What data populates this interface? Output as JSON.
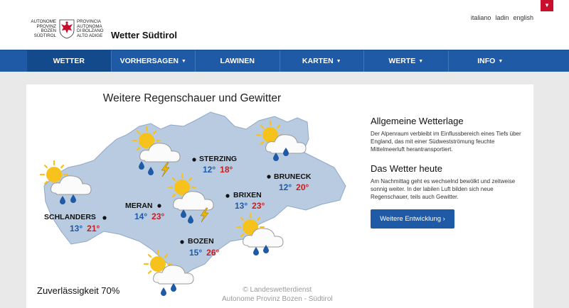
{
  "header": {
    "logo_left": [
      "AUTONOME",
      "PROVINZ",
      "BOZEN",
      "SÜDTIROL"
    ],
    "logo_right": [
      "PROVINCIA",
      "AUTONOMA",
      "DI BOLZANO",
      "ALTO ADIGE"
    ],
    "site_title": "Wetter Südtirol",
    "languages": [
      "italiano",
      "ladin",
      "english"
    ]
  },
  "nav": {
    "items": [
      {
        "label": "WETTER"
      },
      {
        "label": "VORHERSAGEN"
      },
      {
        "label": "LAWINEN"
      },
      {
        "label": "KARTEN"
      },
      {
        "label": "WERTE"
      },
      {
        "label": "INFO"
      }
    ]
  },
  "map": {
    "title": "Weitere Regenschauer und Gewitter",
    "cities": [
      {
        "name": "STERZING",
        "min": "12°",
        "max": "18°"
      },
      {
        "name": "BRUNECK",
        "min": "12°",
        "max": "20°"
      },
      {
        "name": "MERAN",
        "min": "14°",
        "max": "23°"
      },
      {
        "name": "BRIXEN",
        "min": "13°",
        "max": "23°"
      },
      {
        "name": "SCHLANDERS",
        "min": "13°",
        "max": "21°"
      },
      {
        "name": "BOZEN",
        "min": "15°",
        "max": "26°"
      }
    ],
    "reliability": "Zuverlässigkeit 70%",
    "credit_line1": "© Landeswetterdienst",
    "credit_line2": "Autonome Provinz Bozen - Südtirol",
    "colors": {
      "min": "#1f5aa6",
      "max": "#c81e1e",
      "region": "#b9cbe0"
    }
  },
  "sidebar": {
    "heading1": "Allgemeine Wetterlage",
    "text1": "Der Alpenraum verbleibt im Einflussbereich eines Tiefs über England, das mit einer Südwestströmung feuchte Mittelmeerluft herantransportiert.",
    "heading2": "Das Wetter heute",
    "text2": "Am Nachmittag geht es wechselnd bewölkt und zeitweise sonnig weiter. In der labilen Luft bilden sich neue Regenschauer, teils auch Gewitter.",
    "button": "Weitere Entwicklung ›"
  }
}
